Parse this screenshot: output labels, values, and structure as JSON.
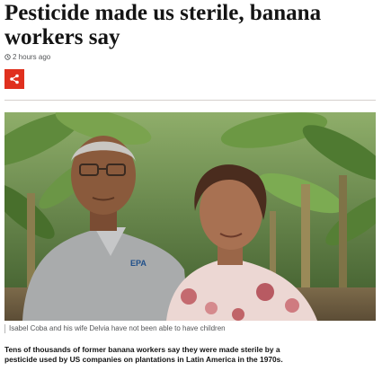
{
  "article": {
    "headline": "Pesticide made us sterile, banana workers say",
    "timestamp": "2 hours ago",
    "caption": "Isabel Coba and his wife Delvia have not been able to have children",
    "lede": "Tens of thousands of former banana workers say they were made sterile by a pesticide used by US companies on plantations in Latin America in the 1970s.",
    "shirt_logo_text": "EPA"
  },
  "icons": {
    "clock": "clock-icon",
    "share": "share-icon"
  },
  "colors": {
    "share_button": "#e0301e",
    "headline": "#141414",
    "meta": "#545658"
  }
}
